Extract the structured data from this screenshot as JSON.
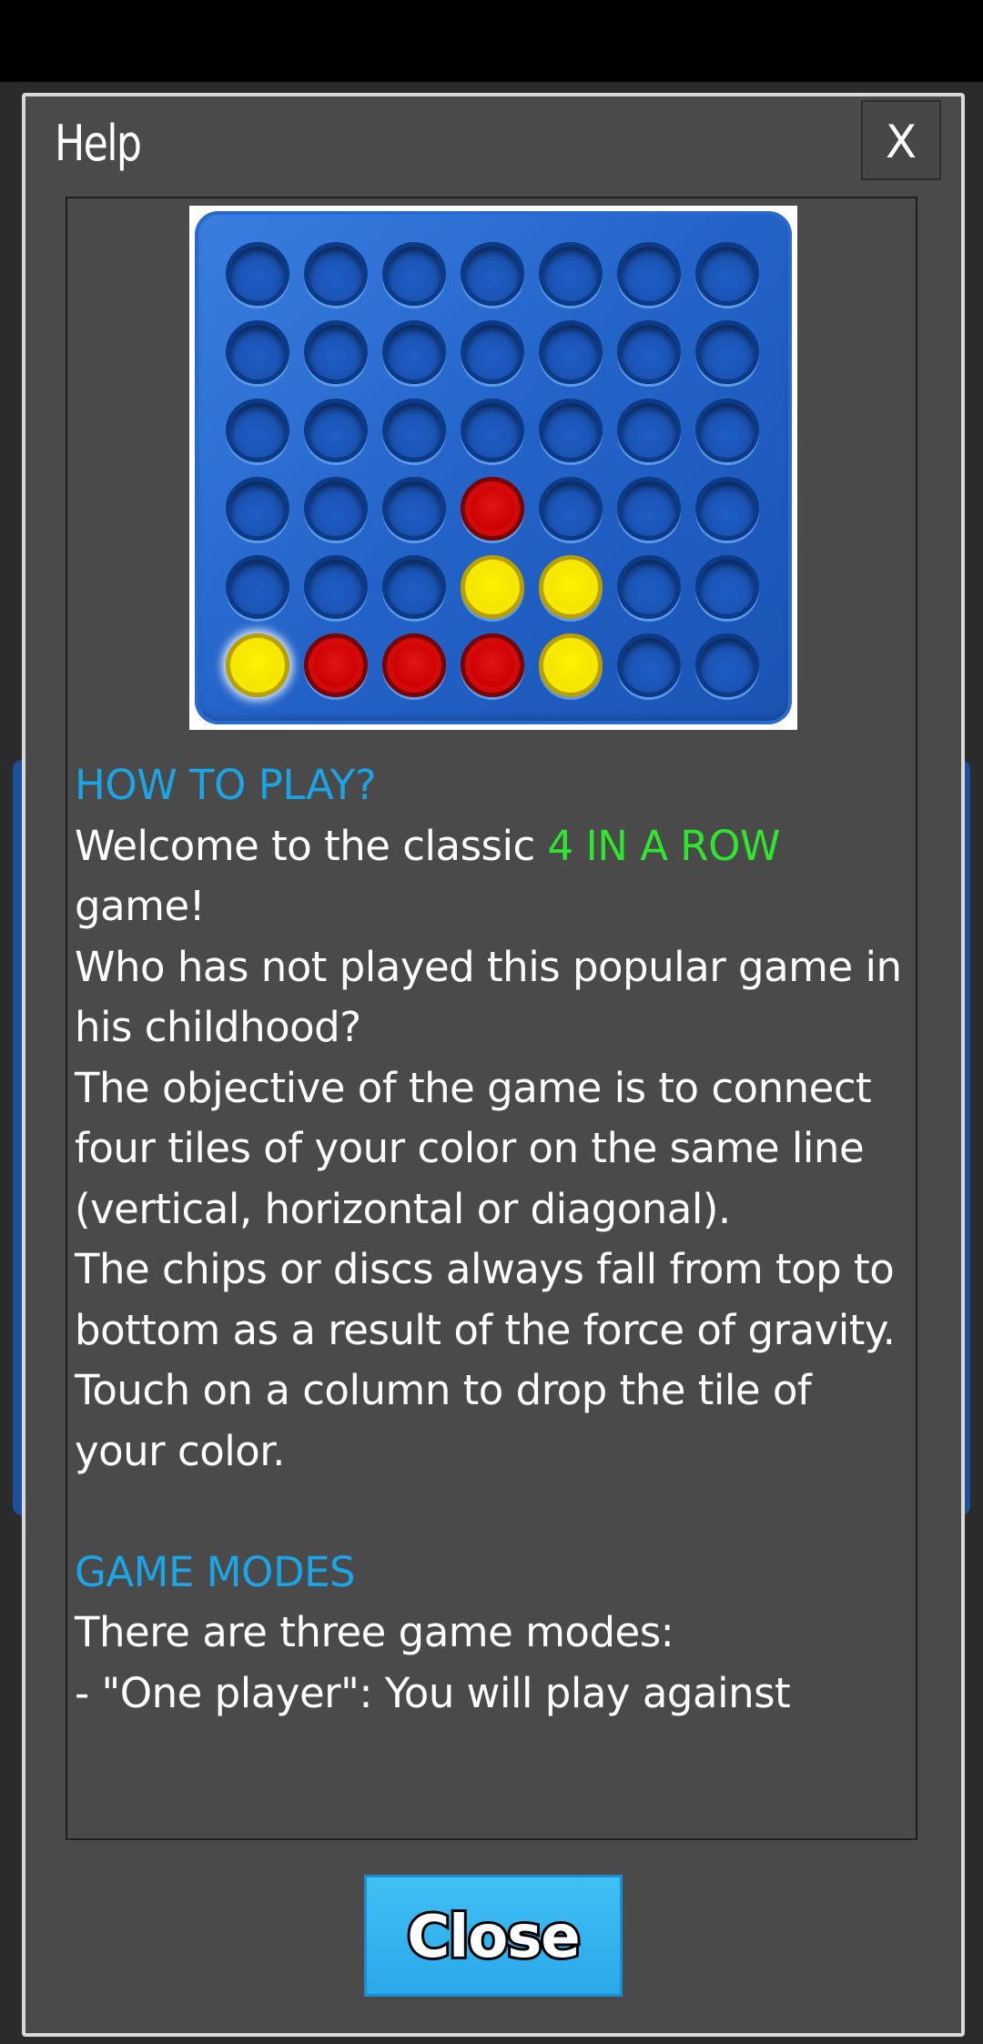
{
  "dialog": {
    "title": "Help",
    "close_x_label": "X",
    "close_button_label": "Close"
  },
  "board_image": {
    "rows": 6,
    "columns": 7,
    "discs": [
      {
        "row": 4,
        "col": 4,
        "color": "red"
      },
      {
        "row": 5,
        "col": 4,
        "color": "yellow"
      },
      {
        "row": 5,
        "col": 5,
        "color": "yellow"
      },
      {
        "row": 6,
        "col": 1,
        "color": "yellow",
        "highlighted": true
      },
      {
        "row": 6,
        "col": 2,
        "color": "red"
      },
      {
        "row": 6,
        "col": 3,
        "color": "red"
      },
      {
        "row": 6,
        "col": 4,
        "color": "red"
      },
      {
        "row": 6,
        "col": 5,
        "color": "yellow"
      }
    ]
  },
  "help": {
    "how_to_play_title": "HOW TO PLAY?",
    "welcome_prefix": "Welcome to the classic ",
    "welcome_highlight": "4 IN A ROW",
    "welcome_suffix": " game!",
    "para_childhood": "Who has not played this popular game in his childhood?",
    "para_objective": "The objective of the game is to connect four tiles of your color on the same line (vertical, horizontal or diagonal).",
    "para_gravity": "The chips or discs always fall from top to bottom as a result of the force of gravity.",
    "para_touch": "Touch on a column to drop the tile of your color.",
    "game_modes_title": "GAME MODES",
    "para_modes": "There are three game modes:",
    "para_one_player": "- \"One player\": You will play against"
  },
  "colors": {
    "section_title": "#1ba4e6",
    "highlight": "#2ee62e",
    "dialog_bg": "#4a4a4a",
    "board_blue": "#2363c8",
    "close_button": "#2aa8ea"
  }
}
